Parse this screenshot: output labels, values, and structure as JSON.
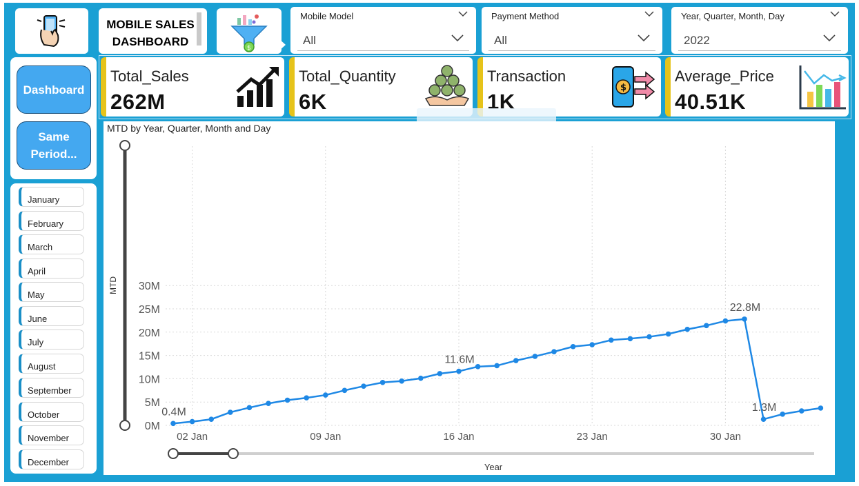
{
  "header": {
    "dashboard_title": "MOBILE  SALES DASHBOARD"
  },
  "icons": {
    "logo": "phone-in-hand-icon",
    "filter": "funnel-filter-icon"
  },
  "filters": [
    {
      "label": "Mobile Model",
      "value": "All"
    },
    {
      "label": "Payment Method",
      "value": "All"
    },
    {
      "label": "Year, Quarter, Month, Day",
      "value": "2022"
    }
  ],
  "nav": {
    "dashboard": "Dashboard",
    "same_period": "Same Period..."
  },
  "months": [
    "January",
    "February",
    "March",
    "April",
    "May",
    "June",
    "July",
    "August",
    "September",
    "October",
    "November",
    "December"
  ],
  "kpis": [
    {
      "label": "Total_Sales",
      "value": "262M",
      "icon": "trending-up-chart-icon"
    },
    {
      "label": "Total_Quantity",
      "value": "6K",
      "icon": "coins-in-hand-icon"
    },
    {
      "label": "Transaction",
      "value": "1K",
      "icon": "phone-transfer-icon"
    },
    {
      "label": "Average_Price",
      "value": "40.51K",
      "icon": "bar-chart-trend-icon"
    }
  ],
  "colors": {
    "frame": "#1aa0d4",
    "line": "#1e88e5",
    "nav_button": "#44a8f0",
    "kpi_accent": "#e6c31a"
  },
  "chart_data": {
    "type": "line",
    "title": "MTD by Year, Quarter, Month and Day",
    "xlabel": "Year",
    "ylabel": "MTD",
    "ylim": [
      0,
      30
    ],
    "y_ticks": [
      "0M",
      "5M",
      "10M",
      "15M",
      "20M",
      "25M",
      "30M"
    ],
    "x_ticks": [
      "02 Jan",
      "09 Jan",
      "16 Jan",
      "23 Jan",
      "30 Jan"
    ],
    "grid": true,
    "series": [
      {
        "values_unit": "M",
        "x": [
          "2022-01-01",
          "2022-01-02",
          "2022-01-03",
          "2022-01-04",
          "2022-01-05",
          "2022-01-06",
          "2022-01-07",
          "2022-01-08",
          "2022-01-09",
          "2022-01-10",
          "2022-01-11",
          "2022-01-12",
          "2022-01-13",
          "2022-01-14",
          "2022-01-15",
          "2022-01-16",
          "2022-01-17",
          "2022-01-18",
          "2022-01-19",
          "2022-01-20",
          "2022-01-21",
          "2022-01-22",
          "2022-01-23",
          "2022-01-24",
          "2022-01-25",
          "2022-01-26",
          "2022-01-27",
          "2022-01-28",
          "2022-01-29",
          "2022-01-30",
          "2022-01-31",
          "2022-02-01",
          "2022-02-02",
          "2022-02-03",
          "2022-02-04"
        ],
        "values": [
          0.4,
          0.8,
          1.3,
          2.8,
          3.8,
          4.7,
          5.4,
          5.9,
          6.5,
          7.5,
          8.4,
          9.2,
          9.5,
          10.1,
          11.1,
          11.6,
          12.6,
          12.8,
          13.9,
          14.8,
          15.8,
          16.9,
          17.3,
          18.3,
          18.6,
          19.0,
          19.6,
          20.6,
          21.4,
          22.4,
          22.8,
          1.3,
          2.4,
          3.1,
          3.7
        ]
      }
    ],
    "data_labels": [
      {
        "x": "2022-01-01",
        "text": "0.4M"
      },
      {
        "x": "2022-01-16",
        "text": "11.6M"
      },
      {
        "x": "2022-01-31",
        "text": "22.8M"
      },
      {
        "x": "2022-02-01",
        "text": "1.3M"
      }
    ]
  }
}
